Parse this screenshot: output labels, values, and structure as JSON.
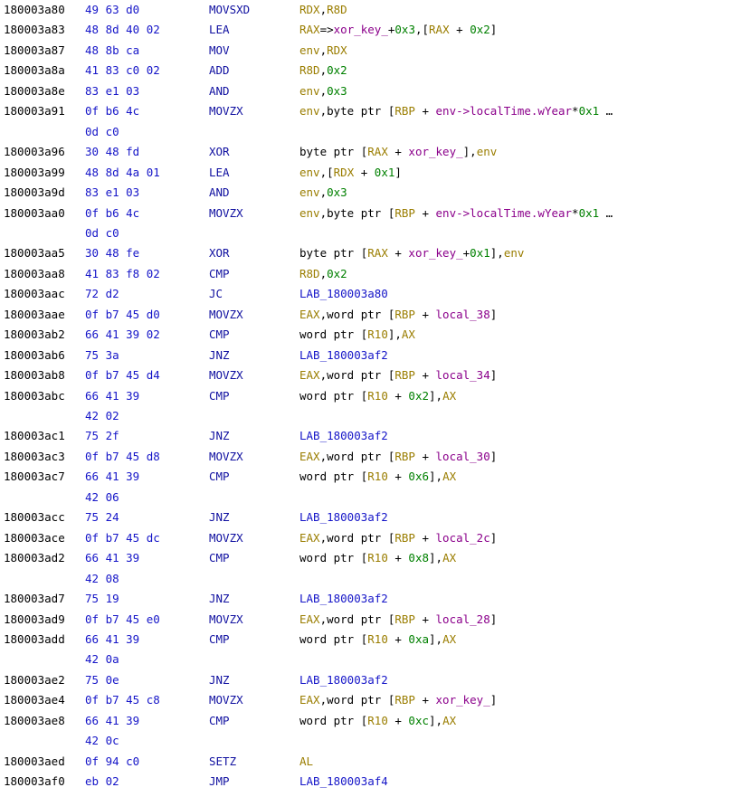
{
  "colors": {
    "text": "#000000",
    "register": "#9a7d00",
    "number": "#008000",
    "label": "#1515c8",
    "variable": "#8b008b",
    "mnemonic": "#1010a0",
    "bytes": "#1515c8"
  },
  "rows": [
    {
      "addr": "180003a80",
      "bytes": "49 63 d0",
      "mnem": "MOVSXD",
      "ops": [
        [
          "reg",
          "RDX"
        ],
        [
          "text",
          ","
        ],
        [
          "reg",
          "R8D"
        ]
      ]
    },
    {
      "addr": "180003a83",
      "bytes": "48 8d 40 02",
      "mnem": "LEA",
      "ops": [
        [
          "reg",
          "RAX"
        ],
        [
          "text",
          "=>"
        ],
        [
          "var",
          "xor_key_"
        ],
        [
          "text",
          "+"
        ],
        [
          "num",
          "0x3"
        ],
        [
          "text",
          ",["
        ],
        [
          "reg",
          "RAX"
        ],
        [
          "text",
          " + "
        ],
        [
          "num",
          "0x2"
        ],
        [
          "text",
          "]"
        ]
      ]
    },
    {
      "addr": "180003a87",
      "bytes": "48 8b ca",
      "mnem": "MOV",
      "ops": [
        [
          "reg",
          "env"
        ],
        [
          "text",
          ","
        ],
        [
          "reg",
          "RDX"
        ]
      ]
    },
    {
      "addr": "180003a8a",
      "bytes": "41 83 c0 02",
      "mnem": "ADD",
      "ops": [
        [
          "reg",
          "R8D"
        ],
        [
          "text",
          ","
        ],
        [
          "num",
          "0x2"
        ]
      ]
    },
    {
      "addr": "180003a8e",
      "bytes": "83 e1 03",
      "mnem": "AND",
      "ops": [
        [
          "reg",
          "env"
        ],
        [
          "text",
          ","
        ],
        [
          "num",
          "0x3"
        ]
      ]
    },
    {
      "addr": "180003a91",
      "bytes": "0f b6 4c",
      "mnem": "MOVZX",
      "ops": [
        [
          "reg",
          "env"
        ],
        [
          "text",
          ",byte ptr ["
        ],
        [
          "reg",
          "RBP"
        ],
        [
          "text",
          " + "
        ],
        [
          "var",
          "env->localTime.wYear"
        ],
        [
          "text",
          "*"
        ],
        [
          "num",
          "0x1"
        ],
        [
          "text",
          " …"
        ]
      ]
    },
    {
      "addr": "",
      "bytes": "0d c0",
      "mnem": "",
      "ops": []
    },
    {
      "addr": "180003a96",
      "bytes": "30 48 fd",
      "mnem": "XOR",
      "ops": [
        [
          "text",
          "byte ptr ["
        ],
        [
          "reg",
          "RAX"
        ],
        [
          "text",
          " + "
        ],
        [
          "var",
          "xor_key_"
        ],
        [
          "text",
          "],"
        ],
        [
          "reg",
          "env"
        ]
      ]
    },
    {
      "addr": "180003a99",
      "bytes": "48 8d 4a 01",
      "mnem": "LEA",
      "ops": [
        [
          "reg",
          "env"
        ],
        [
          "text",
          ",["
        ],
        [
          "reg",
          "RDX"
        ],
        [
          "text",
          " + "
        ],
        [
          "num",
          "0x1"
        ],
        [
          "text",
          "]"
        ]
      ]
    },
    {
      "addr": "180003a9d",
      "bytes": "83 e1 03",
      "mnem": "AND",
      "ops": [
        [
          "reg",
          "env"
        ],
        [
          "text",
          ","
        ],
        [
          "num",
          "0x3"
        ]
      ]
    },
    {
      "addr": "180003aa0",
      "bytes": "0f b6 4c",
      "mnem": "MOVZX",
      "ops": [
        [
          "reg",
          "env"
        ],
        [
          "text",
          ",byte ptr ["
        ],
        [
          "reg",
          "RBP"
        ],
        [
          "text",
          " + "
        ],
        [
          "var",
          "env->localTime.wYear"
        ],
        [
          "text",
          "*"
        ],
        [
          "num",
          "0x1"
        ],
        [
          "text",
          " …"
        ]
      ]
    },
    {
      "addr": "",
      "bytes": "0d c0",
      "mnem": "",
      "ops": []
    },
    {
      "addr": "180003aa5",
      "bytes": "30 48 fe",
      "mnem": "XOR",
      "ops": [
        [
          "text",
          "byte ptr ["
        ],
        [
          "reg",
          "RAX"
        ],
        [
          "text",
          " + "
        ],
        [
          "var",
          "xor_key_"
        ],
        [
          "text",
          "+"
        ],
        [
          "num",
          "0x1"
        ],
        [
          "text",
          "],"
        ],
        [
          "reg",
          "env"
        ]
      ]
    },
    {
      "addr": "180003aa8",
      "bytes": "41 83 f8 02",
      "mnem": "CMP",
      "ops": [
        [
          "reg",
          "R8D"
        ],
        [
          "text",
          ","
        ],
        [
          "num",
          "0x2"
        ]
      ]
    },
    {
      "addr": "180003aac",
      "bytes": "72 d2",
      "mnem": "JC",
      "ops": [
        [
          "lbl",
          "LAB_180003a80"
        ]
      ]
    },
    {
      "addr": "180003aae",
      "bytes": "0f b7 45 d0",
      "mnem": "MOVZX",
      "ops": [
        [
          "reg",
          "EAX"
        ],
        [
          "text",
          ",word ptr ["
        ],
        [
          "reg",
          "RBP"
        ],
        [
          "text",
          " + "
        ],
        [
          "var",
          "local_38"
        ],
        [
          "text",
          "]"
        ]
      ]
    },
    {
      "addr": "180003ab2",
      "bytes": "66 41 39 02",
      "mnem": "CMP",
      "ops": [
        [
          "text",
          "word ptr ["
        ],
        [
          "reg",
          "R10"
        ],
        [
          "text",
          "],"
        ],
        [
          "reg",
          "AX"
        ]
      ]
    },
    {
      "addr": "180003ab6",
      "bytes": "75 3a",
      "mnem": "JNZ",
      "ops": [
        [
          "lbl",
          "LAB_180003af2"
        ]
      ]
    },
    {
      "addr": "180003ab8",
      "bytes": "0f b7 45 d4",
      "mnem": "MOVZX",
      "ops": [
        [
          "reg",
          "EAX"
        ],
        [
          "text",
          ",word ptr ["
        ],
        [
          "reg",
          "RBP"
        ],
        [
          "text",
          " + "
        ],
        [
          "var",
          "local_34"
        ],
        [
          "text",
          "]"
        ]
      ]
    },
    {
      "addr": "180003abc",
      "bytes": "66 41 39",
      "mnem": "CMP",
      "ops": [
        [
          "text",
          "word ptr ["
        ],
        [
          "reg",
          "R10"
        ],
        [
          "text",
          " + "
        ],
        [
          "num",
          "0x2"
        ],
        [
          "text",
          "],"
        ],
        [
          "reg",
          "AX"
        ]
      ]
    },
    {
      "addr": "",
      "bytes": "42 02",
      "mnem": "",
      "ops": []
    },
    {
      "addr": "180003ac1",
      "bytes": "75 2f",
      "mnem": "JNZ",
      "ops": [
        [
          "lbl",
          "LAB_180003af2"
        ]
      ]
    },
    {
      "addr": "180003ac3",
      "bytes": "0f b7 45 d8",
      "mnem": "MOVZX",
      "ops": [
        [
          "reg",
          "EAX"
        ],
        [
          "text",
          ",word ptr ["
        ],
        [
          "reg",
          "RBP"
        ],
        [
          "text",
          " + "
        ],
        [
          "var",
          "local_30"
        ],
        [
          "text",
          "]"
        ]
      ]
    },
    {
      "addr": "180003ac7",
      "bytes": "66 41 39",
      "mnem": "CMP",
      "ops": [
        [
          "text",
          "word ptr ["
        ],
        [
          "reg",
          "R10"
        ],
        [
          "text",
          " + "
        ],
        [
          "num",
          "0x6"
        ],
        [
          "text",
          "],"
        ],
        [
          "reg",
          "AX"
        ]
      ]
    },
    {
      "addr": "",
      "bytes": "42 06",
      "mnem": "",
      "ops": []
    },
    {
      "addr": "180003acc",
      "bytes": "75 24",
      "mnem": "JNZ",
      "ops": [
        [
          "lbl",
          "LAB_180003af2"
        ]
      ]
    },
    {
      "addr": "180003ace",
      "bytes": "0f b7 45 dc",
      "mnem": "MOVZX",
      "ops": [
        [
          "reg",
          "EAX"
        ],
        [
          "text",
          ",word ptr ["
        ],
        [
          "reg",
          "RBP"
        ],
        [
          "text",
          " + "
        ],
        [
          "var",
          "local_2c"
        ],
        [
          "text",
          "]"
        ]
      ]
    },
    {
      "addr": "180003ad2",
      "bytes": "66 41 39",
      "mnem": "CMP",
      "ops": [
        [
          "text",
          "word ptr ["
        ],
        [
          "reg",
          "R10"
        ],
        [
          "text",
          " + "
        ],
        [
          "num",
          "0x8"
        ],
        [
          "text",
          "],"
        ],
        [
          "reg",
          "AX"
        ]
      ]
    },
    {
      "addr": "",
      "bytes": "42 08",
      "mnem": "",
      "ops": []
    },
    {
      "addr": "180003ad7",
      "bytes": "75 19",
      "mnem": "JNZ",
      "ops": [
        [
          "lbl",
          "LAB_180003af2"
        ]
      ]
    },
    {
      "addr": "180003ad9",
      "bytes": "0f b7 45 e0",
      "mnem": "MOVZX",
      "ops": [
        [
          "reg",
          "EAX"
        ],
        [
          "text",
          ",word ptr ["
        ],
        [
          "reg",
          "RBP"
        ],
        [
          "text",
          " + "
        ],
        [
          "var",
          "local_28"
        ],
        [
          "text",
          "]"
        ]
      ]
    },
    {
      "addr": "180003add",
      "bytes": "66 41 39",
      "mnem": "CMP",
      "ops": [
        [
          "text",
          "word ptr ["
        ],
        [
          "reg",
          "R10"
        ],
        [
          "text",
          " + "
        ],
        [
          "num",
          "0xa"
        ],
        [
          "text",
          "],"
        ],
        [
          "reg",
          "AX"
        ]
      ]
    },
    {
      "addr": "",
      "bytes": "42 0a",
      "mnem": "",
      "ops": []
    },
    {
      "addr": "180003ae2",
      "bytes": "75 0e",
      "mnem": "JNZ",
      "ops": [
        [
          "lbl",
          "LAB_180003af2"
        ]
      ]
    },
    {
      "addr": "180003ae4",
      "bytes": "0f b7 45 c8",
      "mnem": "MOVZX",
      "ops": [
        [
          "reg",
          "EAX"
        ],
        [
          "text",
          ",word ptr ["
        ],
        [
          "reg",
          "RBP"
        ],
        [
          "text",
          " + "
        ],
        [
          "var",
          "xor_key_"
        ],
        [
          "text",
          "]"
        ]
      ]
    },
    {
      "addr": "180003ae8",
      "bytes": "66 41 39",
      "mnem": "CMP",
      "ops": [
        [
          "text",
          "word ptr ["
        ],
        [
          "reg",
          "R10"
        ],
        [
          "text",
          " + "
        ],
        [
          "num",
          "0xc"
        ],
        [
          "text",
          "],"
        ],
        [
          "reg",
          "AX"
        ]
      ]
    },
    {
      "addr": "",
      "bytes": "42 0c",
      "mnem": "",
      "ops": []
    },
    {
      "addr": "180003aed",
      "bytes": "0f 94 c0",
      "mnem": "SETZ",
      "ops": [
        [
          "reg",
          "AL"
        ]
      ]
    },
    {
      "addr": "180003af0",
      "bytes": "eb 02",
      "mnem": "JMP",
      "ops": [
        [
          "lbl",
          "LAB_180003af4"
        ]
      ]
    }
  ]
}
